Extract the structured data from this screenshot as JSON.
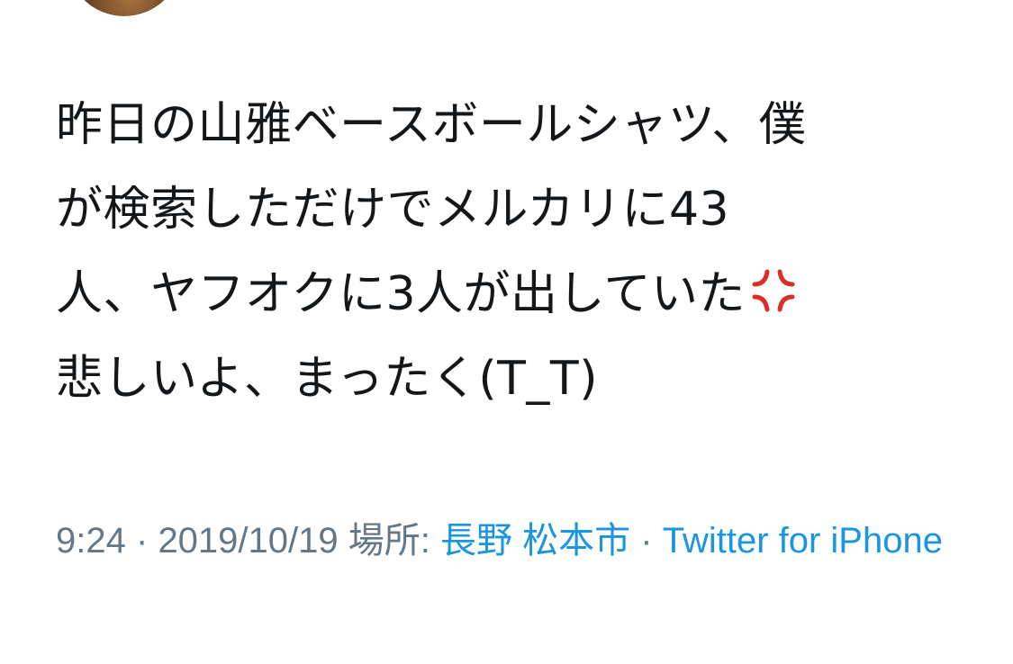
{
  "tweet": {
    "line1": "昨日の山雅ベースボールシャツ、僕",
    "line2": "が検索しただけでメルカリに43",
    "line3": "人、ヤフオクに3人が出していた",
    "line4": "悲しいよ、まったく(T_T)",
    "emoji_icon": "anger-symbol-icon",
    "emoji_color": "#d93025"
  },
  "meta": {
    "time": "9:24",
    "separator": "·",
    "date": "2019/10/19",
    "location_label": "場所:",
    "location": "長野 松本市",
    "source": "Twitter for iPhone"
  },
  "colors": {
    "text": "#14171a",
    "muted": "#657786",
    "link": "#1b95e0"
  }
}
